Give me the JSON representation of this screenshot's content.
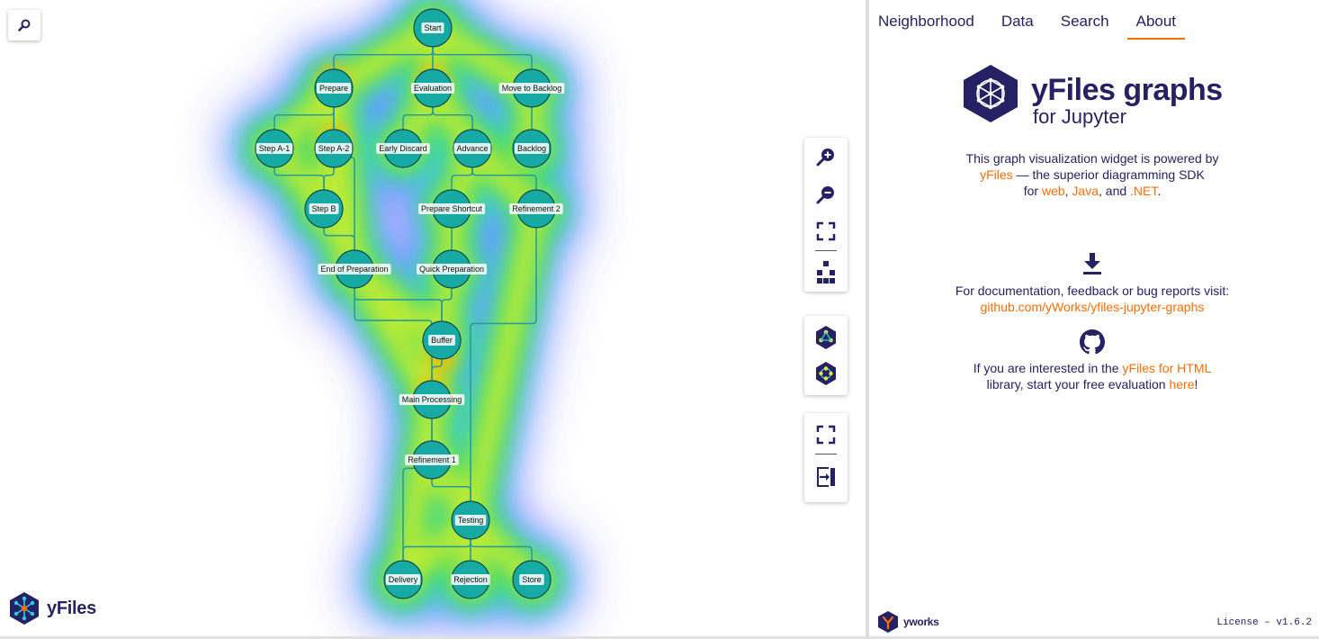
{
  "tabs": [
    "Neighborhood",
    "Data",
    "Search",
    "About"
  ],
  "active_tab": "About",
  "brand": {
    "title": "yFiles graphs",
    "subtitle": "for Jupyter"
  },
  "about": {
    "powered_1": "This graph visualization widget is powered by",
    "yfiles_link": "yFiles",
    "powered_2": " — the superior diagramming SDK",
    "for_text": "for ",
    "web": "web",
    "comma": ", ",
    "java": "Java",
    "and_text": ", and ",
    "net": ".NET",
    "period": ".",
    "docs_text": "For documentation, feedback or bug reports visit:",
    "github_link": "github.com/yWorks/yfiles-jupyter-graphs",
    "interested_1": "If you are interested in the ",
    "html_link": "yFiles for HTML",
    "interested_2": "library, start your free evaluation ",
    "here_link": "here",
    "exclaim": "!"
  },
  "canvas_logo": "yFiles",
  "footer_logo": "yworks",
  "license": "License – v1.6.2",
  "colors": {
    "node_fill": "#17a9a4",
    "node_stroke": "#0e4a48",
    "edge": "#2a9d96",
    "brand": "#242265",
    "accent": "#ff6c00"
  },
  "icons": {
    "search": "search-icon",
    "zoom_in": "zoom-in-icon",
    "zoom_out": "zoom-out-icon",
    "fit": "fit-content-icon",
    "layout": "layout-icon",
    "hex1": "graph-style-icon",
    "hex2": "graph-layout-icon",
    "fullscreen": "fullscreen-icon",
    "side_panel": "toggle-panel-icon",
    "download": "download-icon",
    "github": "github-icon"
  },
  "graph": {
    "nodes": [
      {
        "id": "start",
        "label": "Start"
      },
      {
        "id": "prepare",
        "label": "Prepare"
      },
      {
        "id": "evaluation",
        "label": "Evaluation"
      },
      {
        "id": "move_backlog",
        "label": "Move to Backlog"
      },
      {
        "id": "step_a1",
        "label": "Step A-1"
      },
      {
        "id": "step_a2",
        "label": "Step A-2"
      },
      {
        "id": "early_discard",
        "label": "Early Discard"
      },
      {
        "id": "advance",
        "label": "Advance"
      },
      {
        "id": "backlog",
        "label": "Backlog"
      },
      {
        "id": "step_b",
        "label": "Step B"
      },
      {
        "id": "prep_shortcut",
        "label": "Prepare Shortcut"
      },
      {
        "id": "refinement2",
        "label": "Refinement 2"
      },
      {
        "id": "end_prep",
        "label": "End of Preparation"
      },
      {
        "id": "quick_prep",
        "label": "Quick Preparation"
      },
      {
        "id": "buffer",
        "label": "Buffer"
      },
      {
        "id": "main_proc",
        "label": "Main Processing"
      },
      {
        "id": "refinement1",
        "label": "Refinement 1"
      },
      {
        "id": "testing",
        "label": "Testing"
      },
      {
        "id": "delivery",
        "label": "Delivery"
      },
      {
        "id": "rejection",
        "label": "Rejection"
      },
      {
        "id": "store",
        "label": "Store"
      }
    ],
    "edges": [
      [
        "start",
        "prepare"
      ],
      [
        "start",
        "evaluation"
      ],
      [
        "start",
        "move_backlog"
      ],
      [
        "prepare",
        "step_a1"
      ],
      [
        "prepare",
        "step_a2"
      ],
      [
        "prepare",
        "end_prep"
      ],
      [
        "evaluation",
        "early_discard"
      ],
      [
        "evaluation",
        "advance"
      ],
      [
        "move_backlog",
        "backlog"
      ],
      [
        "step_a1",
        "step_b"
      ],
      [
        "step_a2",
        "step_b"
      ],
      [
        "step_b",
        "end_prep"
      ],
      [
        "advance",
        "prep_shortcut"
      ],
      [
        "advance",
        "refinement2"
      ],
      [
        "prep_shortcut",
        "quick_prep"
      ],
      [
        "end_prep",
        "buffer"
      ],
      [
        "end_prep",
        "main_proc"
      ],
      [
        "quick_prep",
        "buffer"
      ],
      [
        "buffer",
        "main_proc"
      ],
      [
        "main_proc",
        "refinement1"
      ],
      [
        "main_proc",
        "delivery"
      ],
      [
        "refinement1",
        "testing"
      ],
      [
        "refinement2",
        "testing"
      ],
      [
        "testing",
        "delivery"
      ],
      [
        "testing",
        "rejection"
      ],
      [
        "testing",
        "store"
      ]
    ]
  }
}
